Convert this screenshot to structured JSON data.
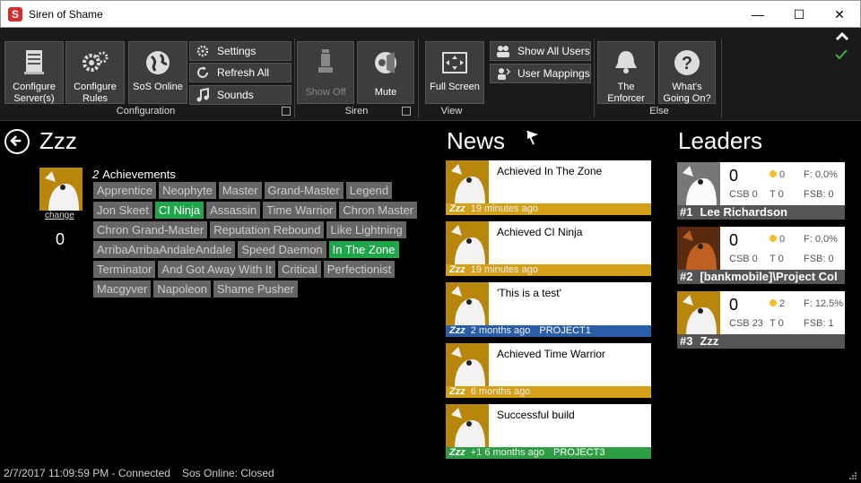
{
  "window": {
    "title": "Siren of Shame",
    "app_icon": "S",
    "controls": {
      "minimize": "—",
      "maximize": "☐",
      "close": "✕"
    }
  },
  "ribbon": {
    "configuration": {
      "label": "Configuration",
      "configure_servers": "Configure Server(s)",
      "configure_rules": "Configure Rules",
      "sos_online": "SoS Online",
      "settings": "Settings",
      "refresh_all": "Refresh All",
      "sounds": "Sounds"
    },
    "siren": {
      "label": "Siren",
      "show_off": "Show Off",
      "mute": "Mute"
    },
    "view": {
      "label": "View",
      "full_screen": "Full Screen",
      "show_all_users": "Show All Users",
      "user_mappings": "User Mappings"
    },
    "else": {
      "label": "Else",
      "the_enforcer": "The Enforcer",
      "whats_going_on": "What's Going On?"
    },
    "collapse_icon": "^",
    "check_icon": "✓"
  },
  "user": {
    "name": "Zzz",
    "change_link": "change",
    "points": "0",
    "achievement_count": "2",
    "achievements_label": "Achievements"
  },
  "achievements": [
    {
      "name": "Apprentice",
      "earned": false
    },
    {
      "name": "Neophyte",
      "earned": false
    },
    {
      "name": "Master",
      "earned": false
    },
    {
      "name": "Grand-Master",
      "earned": false
    },
    {
      "name": "Legend",
      "earned": false
    },
    {
      "name": "Jon Skeet",
      "earned": false
    },
    {
      "name": "CI Ninja",
      "earned": true
    },
    {
      "name": "Assassin",
      "earned": false
    },
    {
      "name": "Time Warrior",
      "earned": false
    },
    {
      "name": "Chron Master",
      "earned": false
    },
    {
      "name": "Chron Grand-Master",
      "earned": false
    },
    {
      "name": "Reputation Rebound",
      "earned": false
    },
    {
      "name": "Like Lightning",
      "earned": false
    },
    {
      "name": "ArribaArribaAndaleAndale",
      "earned": false
    },
    {
      "name": "Speed Daemon",
      "earned": false
    },
    {
      "name": "In The Zone",
      "earned": true
    },
    {
      "name": "Terminator",
      "earned": false
    },
    {
      "name": "And Got Away With It",
      "earned": false
    },
    {
      "name": "Critical",
      "earned": false
    },
    {
      "name": "Perfectionist",
      "earned": false
    },
    {
      "name": "Macgyver",
      "earned": false
    },
    {
      "name": "Napoleon",
      "earned": false
    },
    {
      "name": "Shame Pusher",
      "earned": false
    }
  ],
  "news": {
    "title": "News",
    "items": [
      {
        "text": "Achieved In The Zone",
        "user": "Zzz",
        "time": "19 minutes ago",
        "project": "",
        "bar_color": "#d4a017"
      },
      {
        "text": "Achieved CI Ninja",
        "user": "Zzz",
        "time": "19 minutes ago",
        "project": "",
        "bar_color": "#d4a017"
      },
      {
        "text": "'This is a test'",
        "user": "Zzz",
        "time": "2 months ago",
        "project": "PROJECT1",
        "bar_color": "#2b5ea8"
      },
      {
        "text": "Achieved Time Warrior",
        "user": "Zzz",
        "time": "6 months ago",
        "project": "",
        "bar_color": "#d4a017"
      },
      {
        "text": "Successful build",
        "user": "Zzz",
        "time": "+1 6 months ago",
        "project": "PROJECT3",
        "bar_color": "#2e9e45"
      }
    ]
  },
  "leaders": {
    "title": "Leaders",
    "items": [
      {
        "rank": "#1",
        "name": "Lee Richardson",
        "points": "0",
        "coins": "0",
        "f": "F: 0.0%",
        "csb": "CSB 0",
        "t": "T 0",
        "fsb": "FSB: 0"
      },
      {
        "rank": "#2",
        "name": "[bankmobile]\\Project Col",
        "points": "0",
        "coins": "0",
        "f": "F: 0.0%",
        "csb": "CSB 0",
        "t": "T 0",
        "fsb": "FSB: 0"
      },
      {
        "rank": "#3",
        "name": "Zzz",
        "points": "0",
        "coins": "2",
        "f": "F: 12.5%",
        "csb": "CSB 23",
        "t": "T 0",
        "fsb": "FSB: 1"
      }
    ]
  },
  "status": {
    "datetime": "2/7/2017 11:09:59 PM",
    "connection": "Connected",
    "online": "Sos Online: Closed"
  }
}
